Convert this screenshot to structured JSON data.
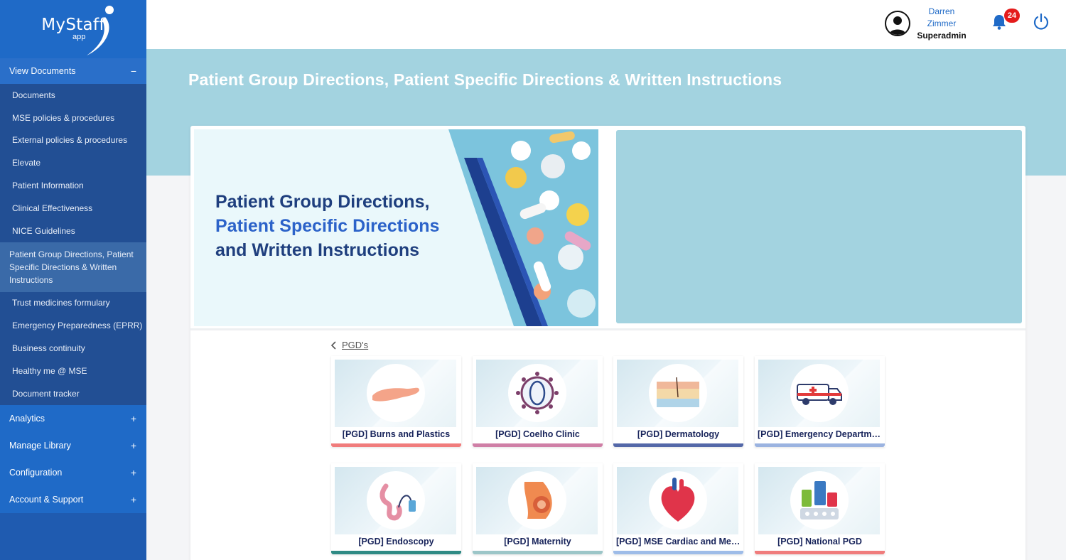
{
  "app": {
    "logo_text": "MyStaff",
    "logo_sub": "app"
  },
  "sidebar": {
    "sections": [
      {
        "label": "View Documents",
        "sign": "−"
      }
    ],
    "items": [
      "Documents",
      "MSE policies & procedures",
      "External policies & procedures",
      "Elevate",
      "Patient Information",
      "Clinical Effectiveness",
      "NICE Guidelines",
      "Patient Group Directions, Patient Specific Directions & Written Instructions",
      "Trust medicines formulary",
      "Emergency Preparedness (EPRR)",
      "Business continuity",
      "Healthy me @ MSE",
      "Document tracker"
    ],
    "collapsed": [
      {
        "label": "Analytics",
        "sign": "+"
      },
      {
        "label": "Manage Library",
        "sign": "+"
      },
      {
        "label": "Configuration",
        "sign": "+"
      },
      {
        "label": "Account & Support",
        "sign": "+"
      }
    ]
  },
  "header": {
    "user_first": "Darren",
    "user_last": "Zimmer",
    "user_role": "Superadmin",
    "notification_count": "24",
    "icons": [
      "avatar-icon",
      "bell-icon",
      "power-icon"
    ]
  },
  "page": {
    "title": "Patient Group Directions, Patient Specific Directions & Written Instructions"
  },
  "banner": {
    "line1": "Patient Group Directions,",
    "line2": "Patient Specific Directions",
    "line3": "and Written Instructions"
  },
  "breadcrumb": {
    "back_icon": "chevron-left-icon",
    "label": "PGD's"
  },
  "tiles": [
    {
      "label": "[PGD] Burns and Plastics",
      "icon": "hand-icon",
      "bar_color": "#f07c7c"
    },
    {
      "label": "[PGD] Coelho Clinic",
      "icon": "virus-icon",
      "bar_color": "#cf7fa6"
    },
    {
      "label": "[PGD] Dermatology",
      "icon": "skin-layers-icon",
      "bar_color": "#5468a8"
    },
    {
      "label": "[PGD] Emergency Department",
      "icon": "ambulance-icon",
      "bar_color": "#9bb3e0"
    },
    {
      "label": "[PGD] Endoscopy",
      "icon": "endoscopy-icon",
      "bar_color": "#2f8a84"
    },
    {
      "label": "[PGD] Maternity",
      "icon": "pregnancy-icon",
      "bar_color": "#9cc6c8"
    },
    {
      "label": "[PGD] MSE Cardiac and Medicine",
      "icon": "heart-icon",
      "bar_color": "#9ebce8"
    },
    {
      "label": "[PGD] National PGD",
      "icon": "medicines-icon",
      "bar_color": "#f07c7c"
    }
  ],
  "colors": {
    "sidebar": "#1f5bb0",
    "hero": "#a3d3e0",
    "badge": "#e41b1b",
    "accent": "#1f6ac7"
  }
}
